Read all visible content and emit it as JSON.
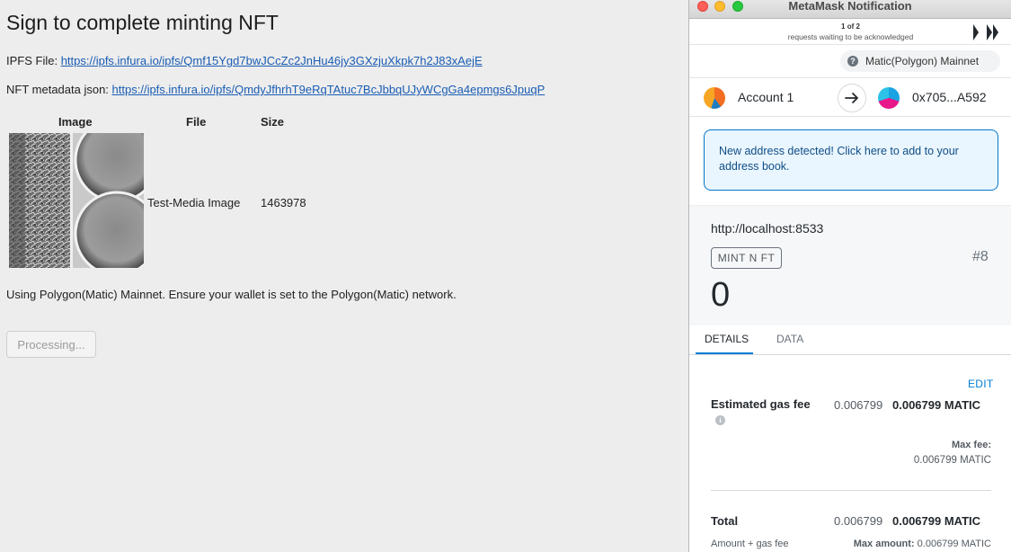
{
  "page": {
    "title": "Sign to complete minting NFT",
    "ipfs_label": "IPFS File: ",
    "ipfs_url": "https://ipfs.infura.io/ipfs/Qmf15Ygd7bwJCcZc2JnHu46jy3GXzjuXkpk7h2J83xAejE",
    "metadata_label": "NFT metadata json: ",
    "metadata_url": "https://ipfs.infura.io/ipfs/QmdyJfhrhT9eRqTAtuc7BcJbbqUJyWCgGa4epmgs6JpuqP",
    "table": {
      "headers": [
        "Image",
        "File",
        "Size"
      ],
      "row": {
        "file": "Test-Media Image",
        "size": "1463978"
      }
    },
    "network_note": "Using Polygon(Matic) Mainnet. Ensure your wallet is set to the Polygon(Matic) network.",
    "processing_button": "Processing..."
  },
  "metamask": {
    "window_title": "MetaMask Notification",
    "queue_count": "1 of 2",
    "queue_note": "requests waiting to be acknowledged",
    "network": "Matic(Polygon) Mainnet",
    "network_help_glyph": "?",
    "from_account": "Account 1",
    "to_address": "0x705...A592",
    "notice": "New address detected! Click here to add to your address book.",
    "origin": "http://localhost:8533",
    "method": "MINT N FT",
    "nonce": "#8",
    "amount": "0",
    "tabs": {
      "details": "DETAILS",
      "data": "DATA"
    },
    "edit": "EDIT",
    "gas": {
      "label": "Estimated gas fee",
      "secondary": "0.006799",
      "primary": "0.006799 MATIC",
      "max_fee_label": "Max fee:",
      "max_fee_value": "0.006799 MATIC"
    },
    "total": {
      "label": "Total",
      "secondary": "0.006799",
      "primary": "0.006799 MATIC",
      "sub_label": "Amount + gas fee",
      "max_amount_label": "Max amount:",
      "max_amount_value": "0.006799 MATIC"
    },
    "info_glyph": "i",
    "colors": {
      "accent": "#037dd6",
      "notice_bg": "#eaf6ff"
    }
  }
}
